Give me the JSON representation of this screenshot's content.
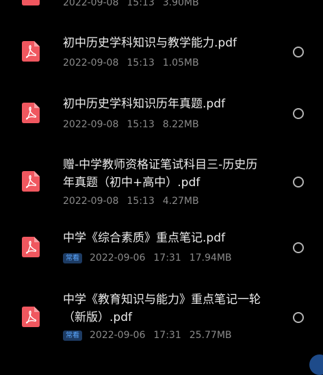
{
  "colors": {
    "background": "#000000",
    "pdf_icon": "#f0575f",
    "badge_bg": "#1d3b63",
    "badge_text": "#5aa7ff"
  },
  "files": [
    {
      "name": "",
      "date": "2022-09-08",
      "time": "15:13",
      "size": "3.90MB",
      "badge": "",
      "icon": "pdf-icon"
    },
    {
      "name": "初中历史学科知识与教学能力.pdf",
      "date": "2022-09-08",
      "time": "15:13",
      "size": "1.05MB",
      "badge": "",
      "icon": "pdf-icon"
    },
    {
      "name": "初中历史学科知识历年真题.pdf",
      "date": "2022-09-08",
      "time": "15:13",
      "size": "8.22MB",
      "badge": "",
      "icon": "pdf-icon"
    },
    {
      "name": "赠-中学教师资格证笔试科目三-历史历年真题（初中+高中）.pdf",
      "date": "2022-09-08",
      "time": "15:13",
      "size": "4.27MB",
      "badge": "",
      "icon": "pdf-icon"
    },
    {
      "name": "中学《综合素质》重点笔记.pdf",
      "date": "2022-09-06",
      "time": "17:31",
      "size": "17.94MB",
      "badge": "常看",
      "icon": "pdf-icon"
    },
    {
      "name": "中学《教育知识与能力》重点笔记一轮（新版）.pdf",
      "date": "2022-09-06",
      "time": "17:31",
      "size": "25.77MB",
      "badge": "常看",
      "icon": "pdf-icon"
    }
  ]
}
